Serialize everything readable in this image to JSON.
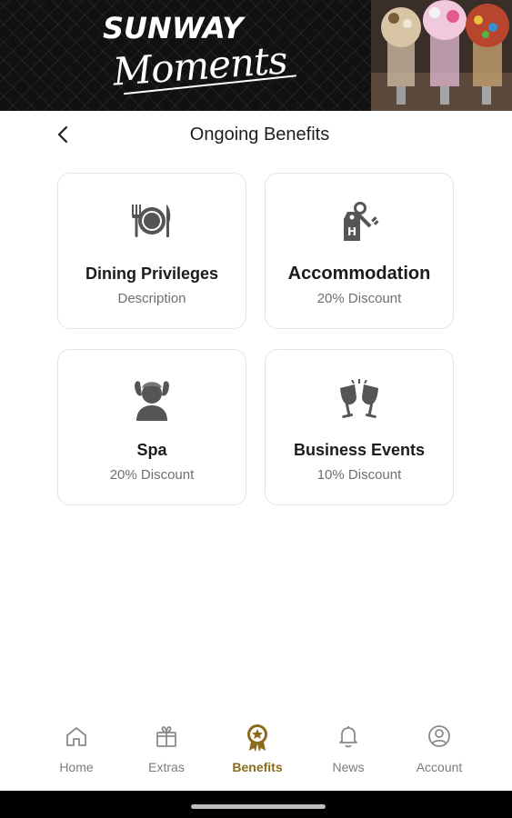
{
  "banner": {
    "brand_top": "SUNWAY",
    "brand_script": "Moments"
  },
  "header": {
    "title": "Ongoing Benefits",
    "back_icon": "chevron-left-icon"
  },
  "cards": [
    {
      "title": "Dining Privileges",
      "subtitle": "Description",
      "icon": "dining-plate-icon"
    },
    {
      "title": "Accommodation",
      "subtitle": "20% Discount",
      "icon": "hotel-key-icon"
    },
    {
      "title": "Spa",
      "subtitle": "20% Discount",
      "icon": "spa-person-icon"
    },
    {
      "title": "Business Events",
      "subtitle": "10% Discount",
      "icon": "champagne-toast-icon"
    }
  ],
  "nav": {
    "items": [
      {
        "label": "Home",
        "icon": "home-icon"
      },
      {
        "label": "Extras",
        "icon": "gift-icon"
      },
      {
        "label": "Benefits",
        "icon": "award-badge-icon",
        "active": true
      },
      {
        "label": "News",
        "icon": "bell-icon"
      },
      {
        "label": "Account",
        "icon": "user-circle-icon"
      }
    ]
  },
  "colors": {
    "accent": "#8a6b1d",
    "icon_gray": "#555555",
    "nav_gray": "#8a8a8a",
    "card_border": "#e4e4e4"
  }
}
